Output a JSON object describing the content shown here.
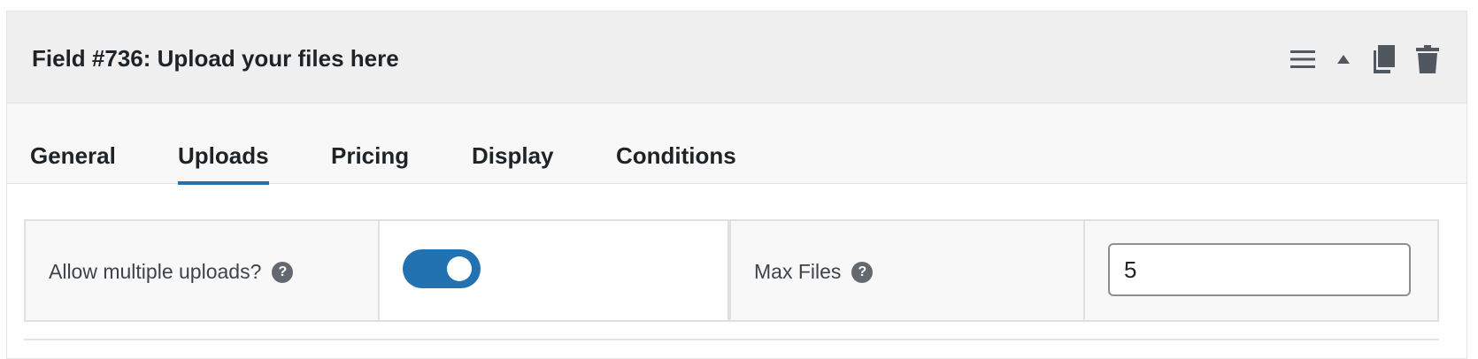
{
  "field": {
    "title": "Field #736: Upload your files here"
  },
  "header": {
    "icons": [
      "menu-icon",
      "collapse-up-icon",
      "duplicate-icon",
      "trash-icon"
    ]
  },
  "tabs": [
    {
      "label": "General",
      "active": false
    },
    {
      "label": "Uploads",
      "active": true
    },
    {
      "label": "Pricing",
      "active": false
    },
    {
      "label": "Display",
      "active": false
    },
    {
      "label": "Conditions",
      "active": false
    }
  ],
  "settings": {
    "allow_multiple": {
      "label": "Allow multiple uploads?",
      "help": "?",
      "enabled": true
    },
    "max_files": {
      "label": "Max Files",
      "help": "?",
      "value": "5"
    }
  },
  "colors": {
    "accent": "#2271b1",
    "header_bg": "#efefef",
    "tabs_bg": "#f8f8f8",
    "help_icon": "#646970"
  }
}
